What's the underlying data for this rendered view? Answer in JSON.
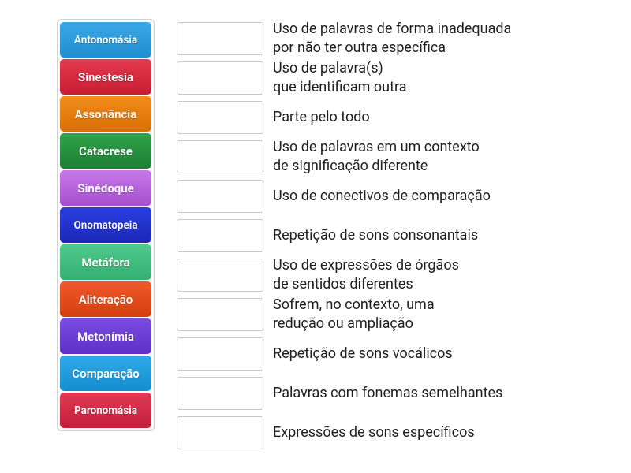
{
  "labels": [
    {
      "text": "Antonomásia",
      "bg": "linear-gradient(#3ba7e6,#1f8fd0)",
      "size": "small"
    },
    {
      "text": "Sinestesia",
      "bg": "linear-gradient(#e53a4f,#c91d34)",
      "size": "normal"
    },
    {
      "text": "Assonância",
      "bg": "linear-gradient(#f28c1a,#d96f05)",
      "size": "normal"
    },
    {
      "text": "Catacrese",
      "bg": "linear-gradient(#2fa24a,#1e7f34)",
      "size": "normal"
    },
    {
      "text": "Sinédoque",
      "bg": "linear-gradient(#c678e8,#a44fcf)",
      "size": "normal"
    },
    {
      "text": "Onomatopeia",
      "bg": "linear-gradient(#2b3fe0,#1a27b8)",
      "size": "small"
    },
    {
      "text": "Metáfora",
      "bg": "linear-gradient(#4fc98a,#34b071)",
      "size": "normal"
    },
    {
      "text": "Aliteração",
      "bg": "linear-gradient(#f05a2a,#d43f10)",
      "size": "normal"
    },
    {
      "text": "Metonímia",
      "bg": "linear-gradient(#7a4de0,#5e30c9)",
      "size": "normal"
    },
    {
      "text": "Comparação",
      "bg": "linear-gradient(#2ea9e6,#158ed0)",
      "size": "normal"
    },
    {
      "text": "Paronomásia",
      "bg": "linear-gradient(#e13a55,#c31e3c)",
      "size": "small"
    }
  ],
  "rows": [
    {
      "definition": "Uso de palavras de forma inadequada\npor não ter outra específica"
    },
    {
      "definition": "Uso de palavra(s)\nque identificam outra"
    },
    {
      "definition": "Parte pelo todo"
    },
    {
      "definition": "Uso de palavras em um contexto\nde significação diferente"
    },
    {
      "definition": "Uso de conectivos de comparação"
    },
    {
      "definition": "Repetição de sons consonantais"
    },
    {
      "definition": "Uso de expressões de órgãos\nde sentidos diferentes"
    },
    {
      "definition": "Sofrem, no contexto, uma\nredução ou ampliação"
    },
    {
      "definition": "Repetição de sons vocálicos"
    },
    {
      "definition": "Palavras com fonemas semelhantes"
    },
    {
      "definition": "Expressões de sons específicos"
    }
  ]
}
